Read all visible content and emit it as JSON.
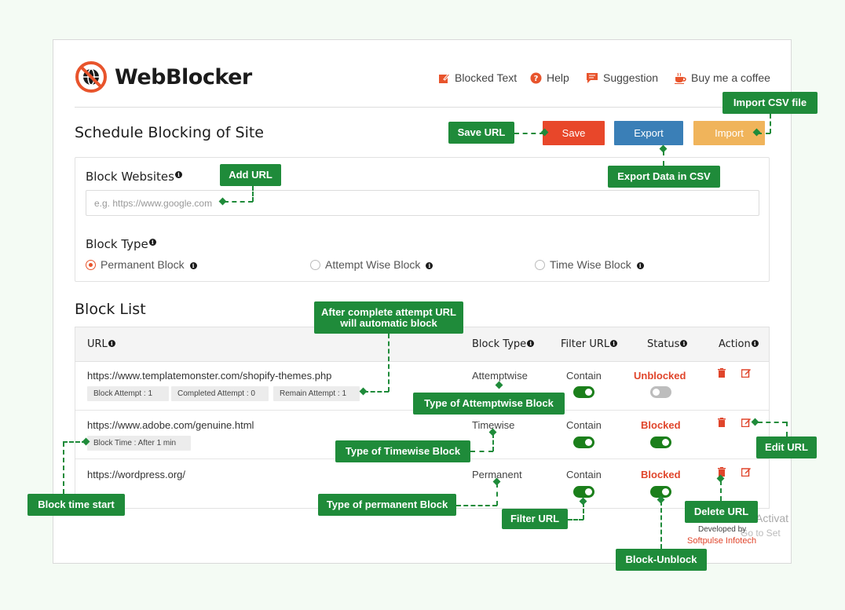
{
  "app": {
    "logo_text": "WebBlocker"
  },
  "nav": {
    "blocked_text": "Blocked Text",
    "help": "Help",
    "suggestion": "Suggestion",
    "coffee": "Buy me a coffee"
  },
  "page": {
    "title": "Schedule Blocking of Site",
    "save": "Save",
    "export": "Export",
    "import": "Import"
  },
  "form": {
    "websites_label": "Block Websites",
    "websites_placeholder": "e.g. https://www.google.com",
    "type_label": "Block Type",
    "options": [
      "Permanent Block",
      "Attempt Wise Block",
      "Time Wise Block"
    ],
    "selected": "Permanent Block"
  },
  "list": {
    "title": "Block List",
    "columns": [
      "URL",
      "Block Type",
      "Filter URL",
      "Status",
      "Action"
    ],
    "rows": [
      {
        "url": "https://www.templatemonster.com/shopify-themes.php",
        "tags": [
          "Block Attempt : 1",
          "Completed Attempt : 0",
          "Remain Attempt : 1"
        ],
        "type": "Attemptwise",
        "filter": "Contain",
        "filter_on": true,
        "status": "Unblocked",
        "status_on": false
      },
      {
        "url": "https://www.adobe.com/genuine.html",
        "tags": [
          "Block Time : After 1 min"
        ],
        "type": "Timewise",
        "filter": "Contain",
        "filter_on": true,
        "status": "Blocked",
        "status_on": true
      },
      {
        "url": "https://wordpress.org/",
        "tags": [],
        "type": "Permanent",
        "filter": "Contain",
        "filter_on": true,
        "status": "Blocked",
        "status_on": true
      }
    ]
  },
  "footer": {
    "developed_by": "Developed by",
    "company": "Softpulse Infotech",
    "watermark_1": "Activat",
    "watermark_2": "Go to Set"
  },
  "callouts": {
    "import_csv": "Import CSV file",
    "save_url": "Save URL",
    "export_csv": "Export Data in CSV",
    "add_url": "Add URL",
    "after_complete": "After complete attempt URL will automatic block",
    "attemptwise_type": "Type of Attemptwise Block",
    "timewise_type": "Type of Timewise Block",
    "edit_url": "Edit URL",
    "block_time_start": "Block time start",
    "permanent_type": "Type of permanent Block",
    "delete_url": "Delete URL",
    "filter_url": "Filter URL",
    "block_unblock": "Block-Unblock"
  },
  "colors": {
    "accent": "#e8542c",
    "save": "#e8472a",
    "export": "#3a7fb7",
    "import": "#f0b45b",
    "callout": "#1f8b3a",
    "toggle_on": "#1b7f1b"
  }
}
